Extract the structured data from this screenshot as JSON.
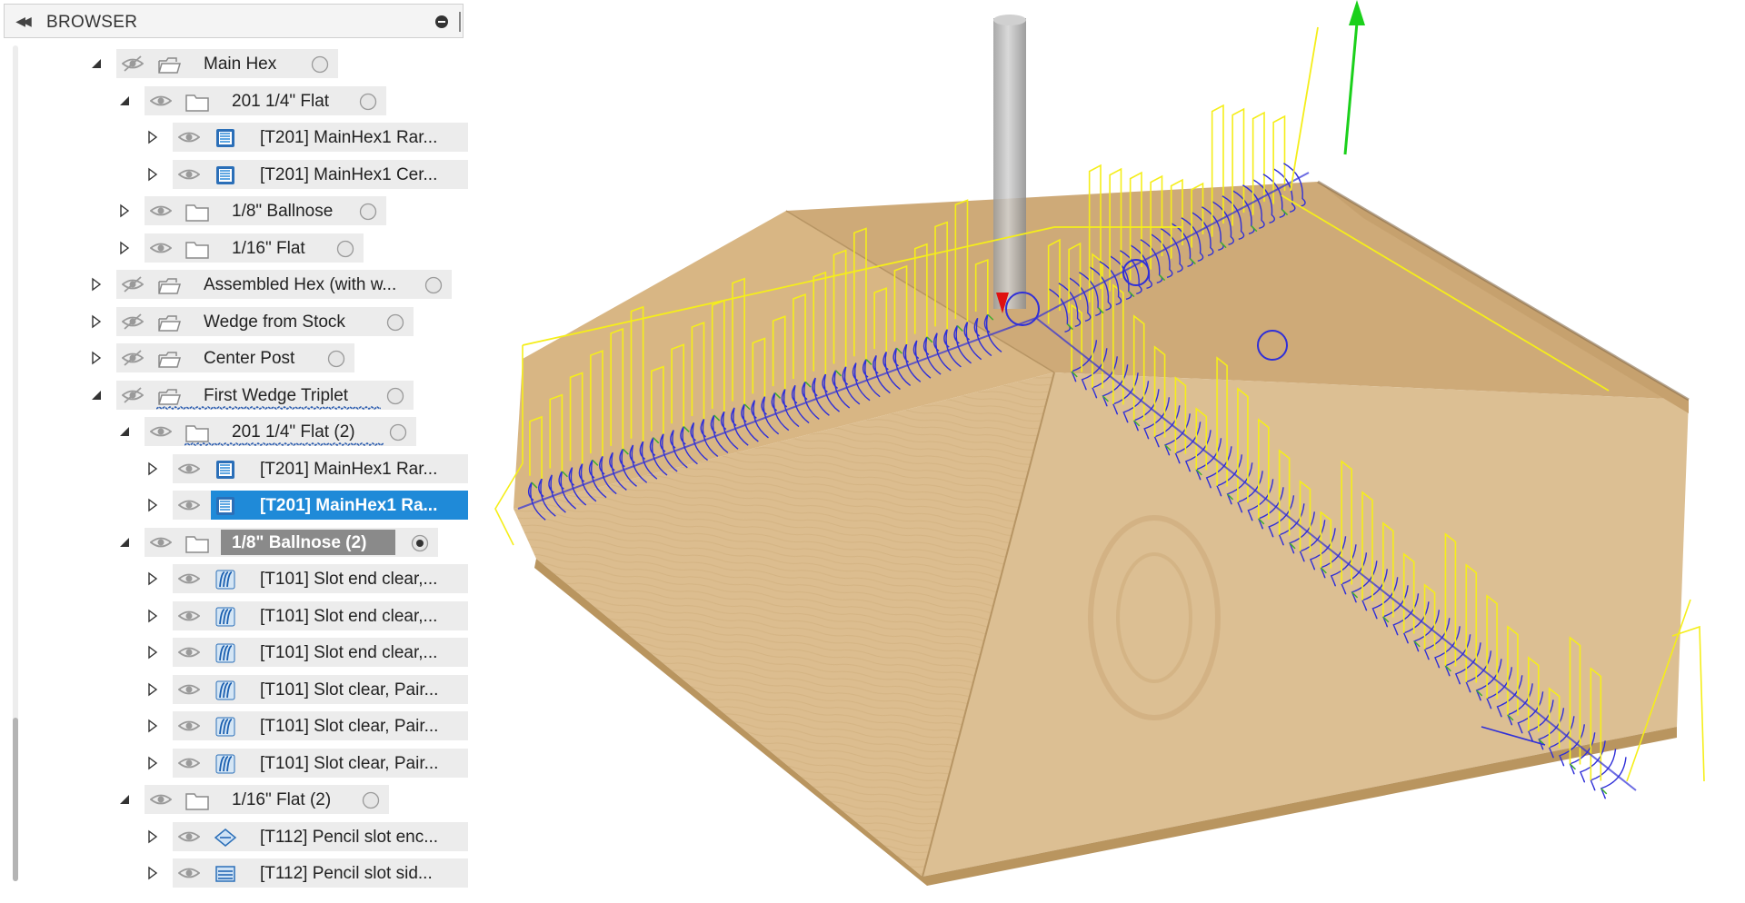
{
  "panel": {
    "title": "BROWSER",
    "collapse_icon": "double-chevron-left-icon",
    "minus_icon": "minus-circle-icon"
  },
  "tree": [
    {
      "label": "Main Hex",
      "type": "setup",
      "expanded": true,
      "visible": false,
      "radio": "empty"
    },
    {
      "label": "201 1/4\" Flat",
      "type": "folder",
      "expanded": true,
      "visible": true,
      "radio": "empty"
    },
    {
      "label": "[T201] MainHex1 Rar...",
      "type": "op-adaptive",
      "expanded": false,
      "visible": true
    },
    {
      "label": "[T201] MainHex1 Cer...",
      "type": "op-adaptive",
      "expanded": false,
      "visible": true
    },
    {
      "label": "1/8\" Ballnose",
      "type": "folder",
      "expanded": false,
      "visible": true,
      "radio": "empty"
    },
    {
      "label": "1/16\" Flat",
      "type": "folder",
      "expanded": false,
      "visible": true,
      "radio": "empty"
    },
    {
      "label": "Assembled Hex (with w...",
      "type": "setup",
      "expanded": false,
      "visible": false,
      "radio": "empty"
    },
    {
      "label": "Wedge from Stock",
      "type": "setup",
      "expanded": false,
      "visible": false,
      "radio": "empty"
    },
    {
      "label": "Center Post",
      "type": "setup",
      "expanded": false,
      "visible": false,
      "radio": "empty"
    },
    {
      "label": "First Wedge Triplet",
      "type": "setup",
      "expanded": true,
      "visible": false,
      "radio": "empty",
      "warning": true
    },
    {
      "label": "201 1/4\" Flat (2)",
      "type": "folder",
      "expanded": true,
      "visible": true,
      "radio": "empty",
      "warning": true
    },
    {
      "label": "[T201] MainHex1 Rar...",
      "type": "op-adaptive",
      "expanded": false,
      "visible": true
    },
    {
      "label": "[T201] MainHex1 Ra...",
      "type": "op-adaptive",
      "expanded": false,
      "visible": true,
      "selected": true
    },
    {
      "label": "1/8\" Ballnose (2)",
      "type": "folder",
      "expanded": true,
      "visible": true,
      "radio": "filled",
      "active": true
    },
    {
      "label": "[T101] Slot end clear,...",
      "type": "op-scallop",
      "expanded": false,
      "visible": true
    },
    {
      "label": "[T101] Slot end clear,...",
      "type": "op-scallop",
      "expanded": false,
      "visible": true
    },
    {
      "label": "[T101] Slot end clear,...",
      "type": "op-scallop",
      "expanded": false,
      "visible": true
    },
    {
      "label": "[T101] Slot clear, Pair...",
      "type": "op-scallop",
      "expanded": false,
      "visible": true
    },
    {
      "label": "[T101] Slot clear, Pair...",
      "type": "op-scallop",
      "expanded": false,
      "visible": true
    },
    {
      "label": "[T101] Slot clear, Pair...",
      "type": "op-scallop",
      "expanded": false,
      "visible": true
    },
    {
      "label": "1/16\" Flat (2)",
      "type": "folder",
      "expanded": true,
      "visible": true,
      "radio": "empty"
    },
    {
      "label": "[T112] Pencil slot enc...",
      "type": "op-pencil",
      "expanded": false,
      "visible": true
    },
    {
      "label": "[T112] Pencil slot sid...",
      "type": "op-contour",
      "expanded": false,
      "visible": true
    }
  ],
  "viewport": {
    "content": "hexagonal-wood-stock-with-toolpaths",
    "colors": {
      "wood": "#d9b98a",
      "wood_dark": "#c9a573",
      "rapid": "#f5ee1a",
      "cutting": "#2f2fd8",
      "lead": "#3fae2f",
      "tool": "#b8b8b8",
      "axis_z": "#1bd01b",
      "tool_tip": "#e01010"
    }
  }
}
